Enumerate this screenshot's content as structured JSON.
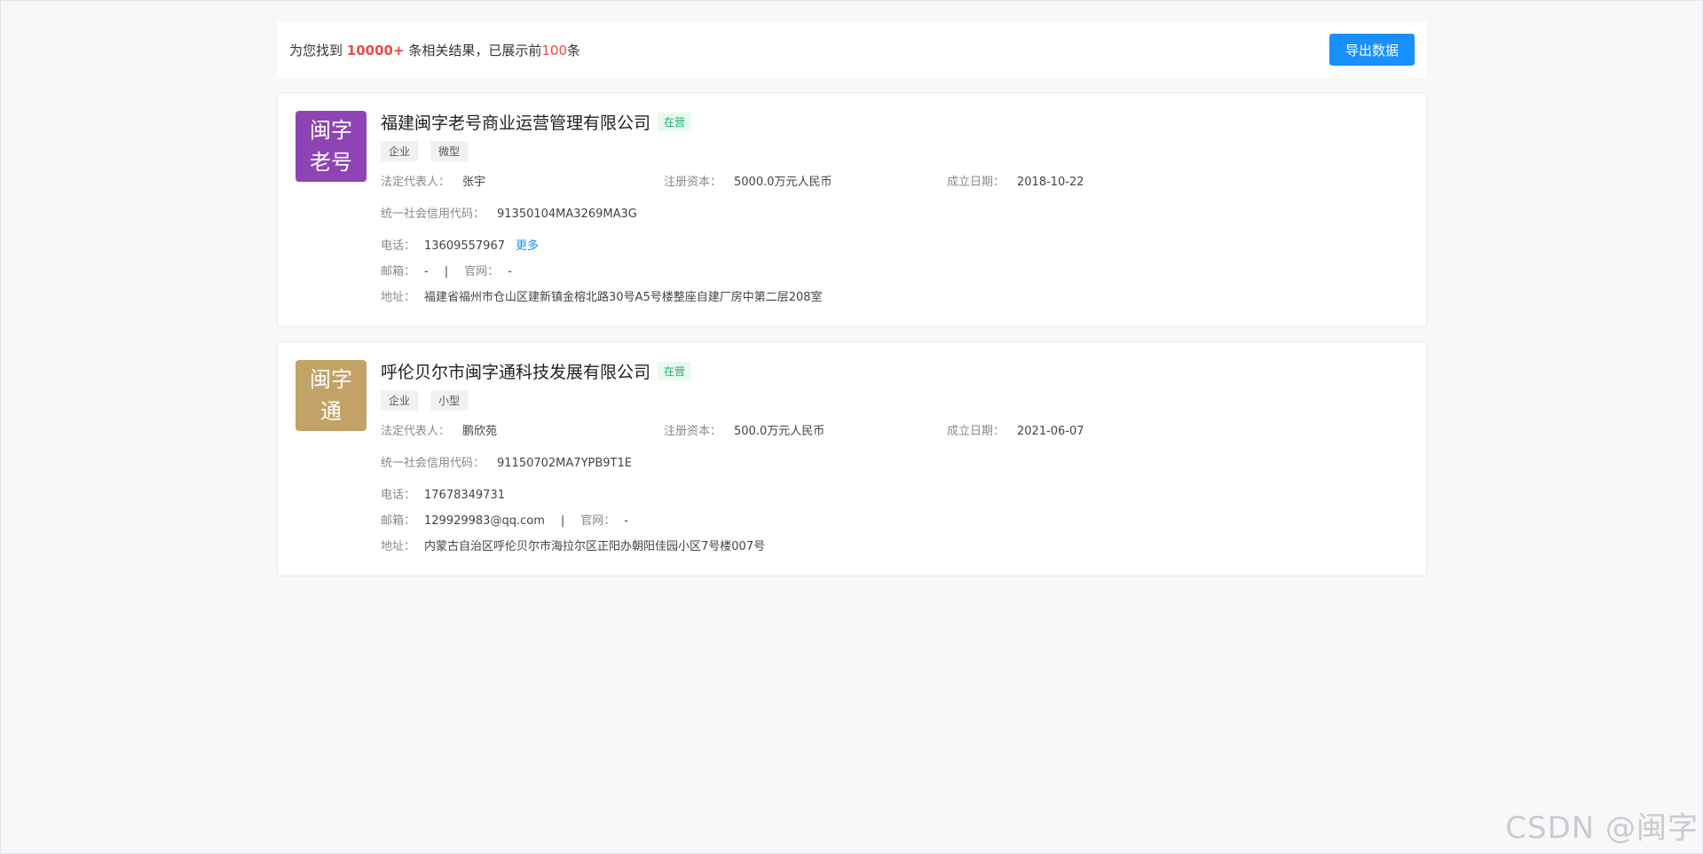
{
  "summary": {
    "prefix": "为您找到",
    "count": "10000+",
    "middle": "条相关结果，已展示前",
    "shown": "100",
    "suffix": "条",
    "export_label": "导出数据"
  },
  "companies": [
    {
      "logo_line1": "闽字",
      "logo_line2": "老号",
      "logo_color": "#8e44b5",
      "name": "福建闽字老号商业运营管理有限公司",
      "status": "在营",
      "tags": [
        "企业",
        "微型"
      ],
      "legal_rep_label": "法定代表人：",
      "legal_rep": "张宇",
      "capital_label": "注册资本：",
      "capital": "5000.0万元人民币",
      "date_label": "成立日期：",
      "date": "2018-10-22",
      "credit_label": "统一社会信用代码：",
      "credit": "91350104MA3269MA3G",
      "phone_label": "电话：",
      "phone": "13609557967",
      "more": "更多",
      "email_label": "邮箱：",
      "email": "-",
      "separator": "|",
      "website_label": "官网：",
      "website": "-",
      "address_label": "地址：",
      "address": "福建省福州市仓山区建新镇金榕北路30号A5号楼整座自建厂房中第二层208室"
    },
    {
      "logo_line1": "闽字",
      "logo_line2": "通",
      "logo_color": "#c2a266",
      "name": "呼伦贝尔市闽字通科技发展有限公司",
      "status": "在营",
      "tags": [
        "企业",
        "小型"
      ],
      "legal_rep_label": "法定代表人：",
      "legal_rep": "鹏欣苑",
      "capital_label": "注册资本：",
      "capital": "500.0万元人民币",
      "date_label": "成立日期：",
      "date": "2021-06-07",
      "credit_label": "统一社会信用代码：",
      "credit": "91150702MA7YPB9T1E",
      "phone_label": "电话：",
      "phone": "17678349731",
      "email_label": "邮箱：",
      "email": "129929983@qq.com",
      "separator": "|",
      "website_label": "官网：",
      "website": "-",
      "address_label": "地址：",
      "address": "内蒙古自治区呼伦贝尔市海拉尔区正阳办朝阳佳园小区7号楼007号"
    }
  ],
  "watermark": "CSDN @闽字"
}
